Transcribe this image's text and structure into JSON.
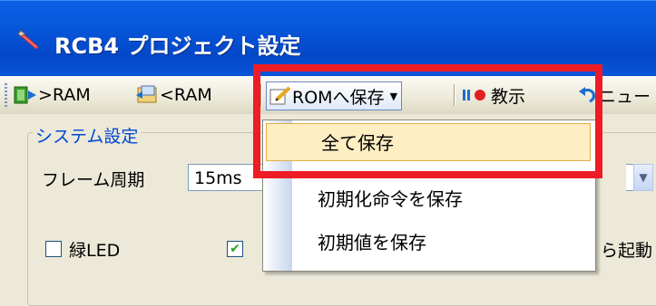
{
  "window": {
    "title": "RCB4 プロジェクト設定"
  },
  "toolbar": {
    "to_ram_label": ">RAM",
    "from_ram_label": "<RAM",
    "rom_save_label": "ROMへ保存",
    "teach_label": "教示",
    "menu_label": "ニュー"
  },
  "system_group": {
    "title": "システム設定",
    "frame_period_label": "フレーム周期",
    "frame_period_value": "15ms",
    "green_led_label": "緑LED",
    "green_led_checked": false,
    "second_checkbox_checked": true,
    "right_text": "ら起動"
  },
  "rom_menu": {
    "items": [
      {
        "label": "全て保存",
        "highlighted": true
      },
      {
        "label": "初期化命令を保存",
        "highlighted": false
      },
      {
        "label": "初期値を保存",
        "highlighted": false
      }
    ]
  },
  "colors": {
    "title_bar": "#0757da",
    "group_title": "#0046d5",
    "highlight_box": "#ee1c25",
    "menu_hover": "#ffeec2"
  }
}
